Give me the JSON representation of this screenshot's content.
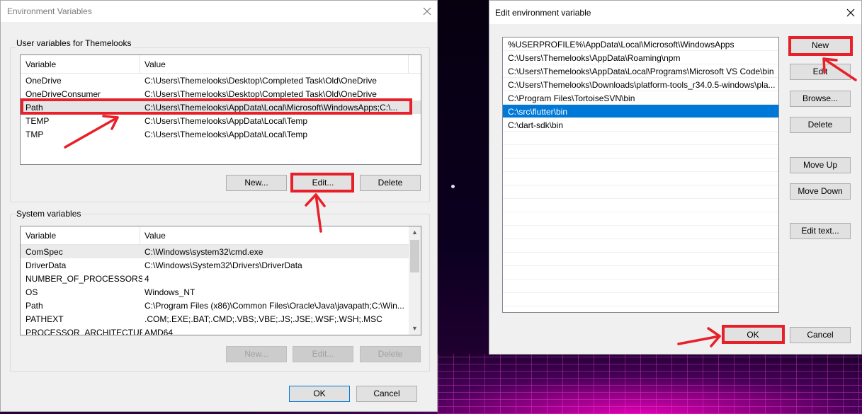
{
  "env_window": {
    "title": "Environment Variables",
    "user_group_label": "User variables for Themelooks",
    "user_columns": [
      "Variable",
      "Value"
    ],
    "user_rows": [
      {
        "variable": "OneDrive",
        "value": "C:\\Users\\Themelooks\\Desktop\\Completed Task\\Old\\OneDrive"
      },
      {
        "variable": "OneDriveConsumer",
        "value": "C:\\Users\\Themelooks\\Desktop\\Completed Task\\Old\\OneDrive"
      },
      {
        "variable": "Path",
        "value": "C:\\Users\\Themelooks\\AppData\\Local\\Microsoft\\WindowsApps;C:\\..."
      },
      {
        "variable": "TEMP",
        "value": "C:\\Users\\Themelooks\\AppData\\Local\\Temp"
      },
      {
        "variable": "TMP",
        "value": "C:\\Users\\Themelooks\\AppData\\Local\\Temp"
      }
    ],
    "user_buttons": {
      "new": "New...",
      "edit": "Edit...",
      "delete": "Delete"
    },
    "system_group_label": "System variables",
    "system_columns": [
      "Variable",
      "Value"
    ],
    "system_rows": [
      {
        "variable": "ComSpec",
        "value": "C:\\Windows\\system32\\cmd.exe"
      },
      {
        "variable": "DriverData",
        "value": "C:\\Windows\\System32\\Drivers\\DriverData"
      },
      {
        "variable": "NUMBER_OF_PROCESSORS",
        "value": "4"
      },
      {
        "variable": "OS",
        "value": "Windows_NT"
      },
      {
        "variable": "Path",
        "value": "C:\\Program Files (x86)\\Common Files\\Oracle\\Java\\javapath;C:\\Win..."
      },
      {
        "variable": "PATHEXT",
        "value": ".COM;.EXE;.BAT;.CMD;.VBS;.VBE;.JS;.JSE;.WSF;.WSH;.MSC"
      },
      {
        "variable": "PROCESSOR_ARCHITECTURE",
        "value": "AMD64"
      }
    ],
    "system_buttons": {
      "new": "New...",
      "edit": "Edit...",
      "delete": "Delete"
    },
    "ok": "OK",
    "cancel": "Cancel"
  },
  "edit_window": {
    "title": "Edit environment variable",
    "paths": [
      "%USERPROFILE%\\AppData\\Local\\Microsoft\\WindowsApps",
      "C:\\Users\\Themelooks\\AppData\\Roaming\\npm",
      "C:\\Users\\Themelooks\\AppData\\Local\\Programs\\Microsoft VS Code\\bin",
      "C:\\Users\\Themelooks\\Downloads\\platform-tools_r34.0.5-windows\\pla...",
      "C:\\Program Files\\TortoiseSVN\\bin",
      "C:\\src\\flutter\\bin",
      "C:\\dart-sdk\\bin"
    ],
    "selected_index": 5,
    "buttons": {
      "new": "New",
      "edit": "Edit",
      "browse": "Browse...",
      "delete": "Delete",
      "move_up": "Move Up",
      "move_down": "Move Down",
      "edit_text": "Edit text..."
    },
    "ok": "OK",
    "cancel": "Cancel"
  },
  "colors": {
    "highlight": "#e8202a",
    "selection": "#0078d7"
  }
}
